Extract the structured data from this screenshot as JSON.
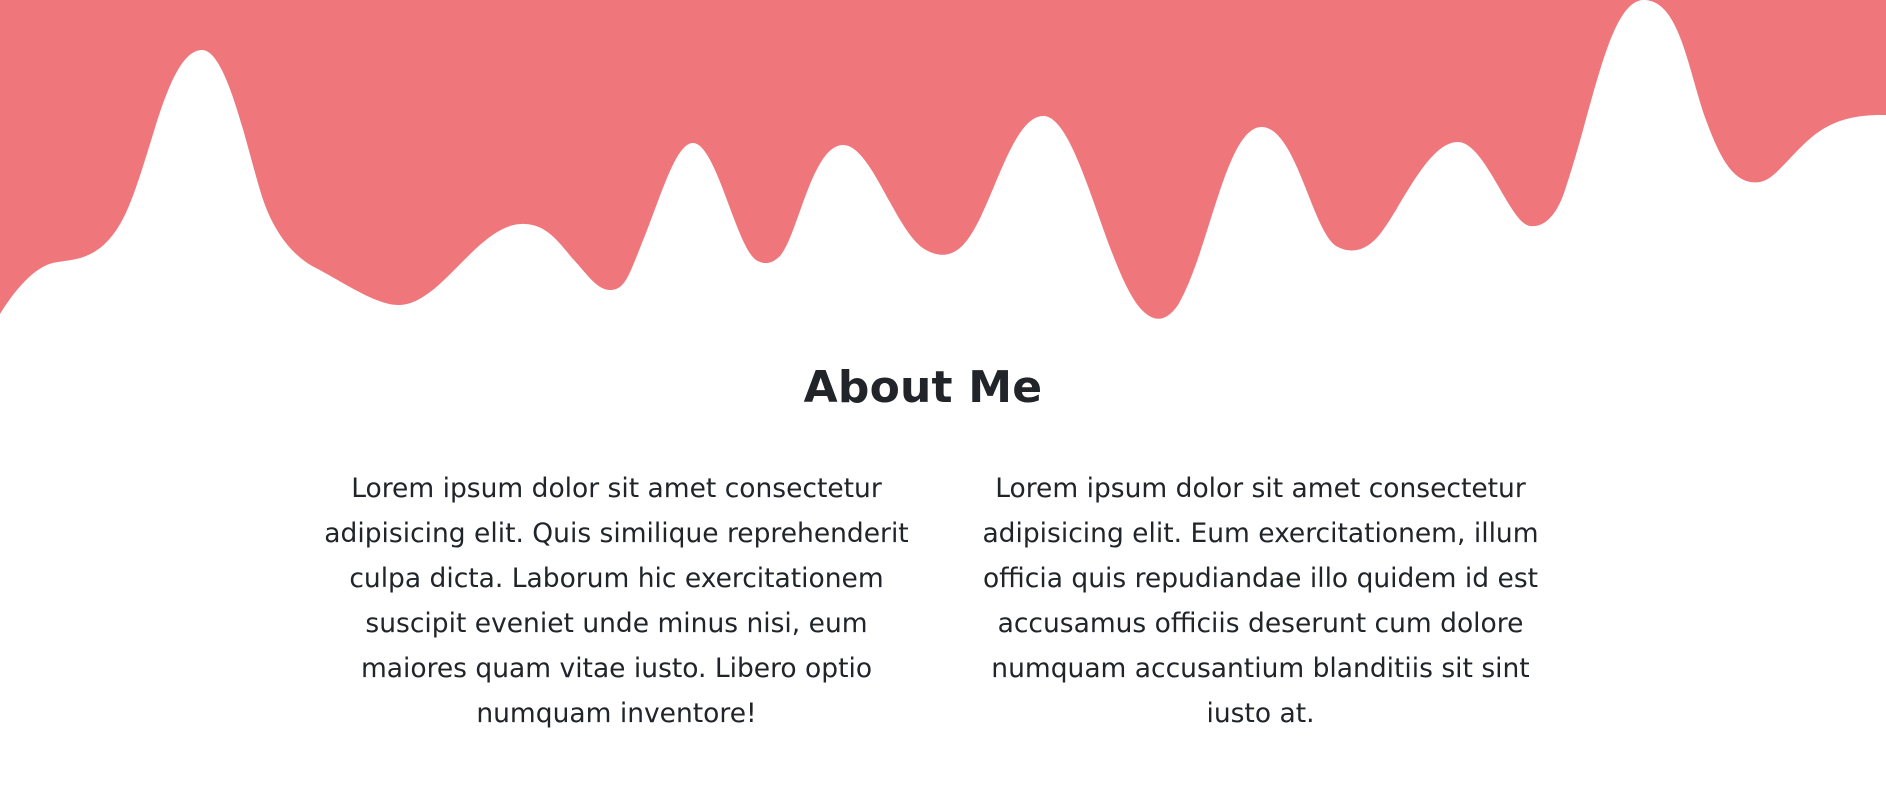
{
  "colors": {
    "wave": "#ef777c",
    "background": "#ffffff",
    "text": "#212529"
  },
  "about": {
    "title": "About Me",
    "paragraphs": [
      "Lorem ipsum dolor sit amet consectetur adipisicing elit. Quis similique reprehenderit culpa dicta. Laborum hic exercitationem suscipit eveniet unde minus nisi, eum maiores quam vitae iusto. Libero optio numquam inventore!",
      "Lorem ipsum dolor sit amet consectetur adipisicing elit. Eum exercitationem, illum officia quis repudiandae illo quidem id est accusamus officiis deserunt cum dolore numquam accusantium blanditiis sit sint iusto at."
    ]
  }
}
